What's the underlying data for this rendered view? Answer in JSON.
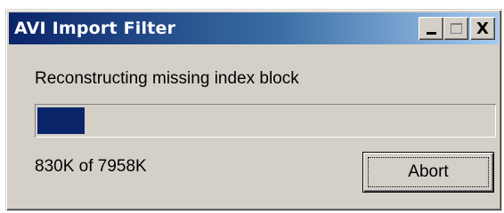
{
  "window": {
    "title": "AVI Import Filter",
    "title_gradient_start": "#0a246a",
    "title_gradient_end": "#a6caf0",
    "face_color": "#d4d0c8"
  },
  "caption_buttons": {
    "minimize_icon": "minimize-icon",
    "maximize_icon": "maximize-icon",
    "close_label": "X"
  },
  "status": {
    "message": "Reconstructing missing index block",
    "readout": "830K of 7958K"
  },
  "progress": {
    "fraction": 0.104,
    "fill_color": "#0a246a"
  },
  "actions": {
    "abort_label": "Abort"
  }
}
